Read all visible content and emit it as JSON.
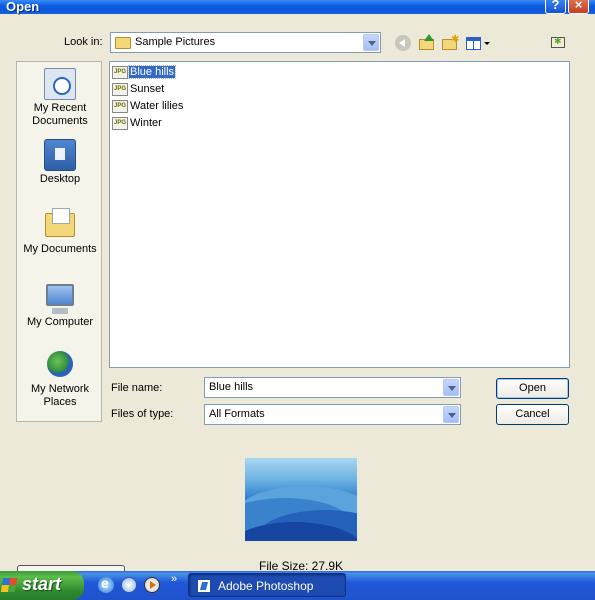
{
  "window": {
    "title": "Open",
    "help_glyph": "?",
    "close_glyph": "×"
  },
  "lookin": {
    "label": "Look in:",
    "value": "Sample Pictures"
  },
  "toolbar": {
    "icons": [
      "back-icon",
      "up-folder-icon",
      "new-folder-icon",
      "views-menu-icon",
      "tools-icon"
    ]
  },
  "places": [
    {
      "label": "My Recent\nDocuments",
      "icon": "recent-documents-icon"
    },
    {
      "label": "Desktop",
      "icon": "desktop-icon"
    },
    {
      "label": "My Documents",
      "icon": "my-documents-icon"
    },
    {
      "label": "My Computer",
      "icon": "my-computer-icon"
    },
    {
      "label": "My Network\nPlaces",
      "icon": "network-places-icon"
    }
  ],
  "files": [
    {
      "name": "Blue hills",
      "badge": "JPG",
      "selected": true
    },
    {
      "name": "Sunset",
      "badge": "JPG",
      "selected": false
    },
    {
      "name": "Water lilies",
      "badge": "JPG",
      "selected": false
    },
    {
      "name": "Winter",
      "badge": "JPG",
      "selected": false
    }
  ],
  "filename": {
    "label": "File name:",
    "value": "Blue hills"
  },
  "filetype": {
    "label": "Files of type:",
    "value": "All Formats"
  },
  "buttons": {
    "open": "Open",
    "cancel": "Cancel"
  },
  "preview": {
    "file_size": "File Size: 27.9K"
  },
  "taskbar": {
    "start": "start",
    "chevron": "»",
    "task_label": "Adobe Photoshop"
  },
  "colors": {
    "title_bar": "#0b57d6",
    "selection": "#316ac5",
    "dialog_bg": "#ece9d8",
    "taskbar": "#2157d7",
    "start_green": "#3c9a3c"
  }
}
